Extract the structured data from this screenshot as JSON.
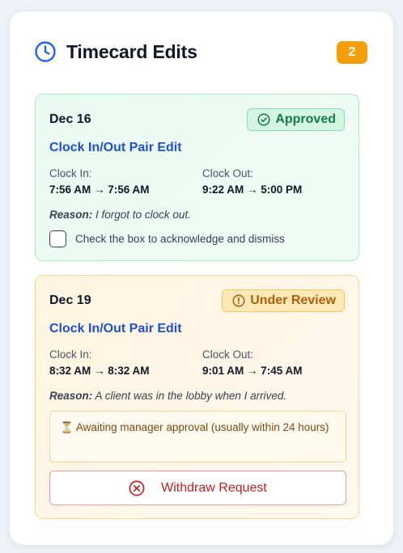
{
  "header": {
    "title": "Timecard Edits",
    "count": "2",
    "icon": "clock-icon",
    "accent": "#2563eb",
    "badge_color": "#f59e0b"
  },
  "cards": [
    {
      "date": "Dec 16",
      "status": "Approved",
      "status_icon": "check-circle-icon",
      "status_color": "#167a48",
      "edit_type": "Clock In/Out Pair Edit",
      "clock_in_label": "Clock In:",
      "clock_in_value": "7:56 AM → 7:56 AM",
      "clock_out_label": "Clock Out:",
      "clock_out_value": "9:22 AM → 5:00 PM",
      "reason_label": "Reason:",
      "reason_text": "I forgot to clock out.",
      "ack_label": "Check the box to acknowledge and dismiss",
      "ack_checked": false
    },
    {
      "date": "Dec 19",
      "status": "Under Review",
      "status_icon": "alert-circle-icon",
      "status_color": "#b35c0a",
      "edit_type": "Clock In/Out Pair Edit",
      "clock_in_label": "Clock In:",
      "clock_in_value": "8:32 AM → 8:32 AM",
      "clock_out_label": "Clock Out:",
      "clock_out_value": "9:01 AM → 7:45 AM",
      "reason_label": "Reason:",
      "reason_text": "A client was in the lobby when I arrived.",
      "awaiting_text": "⏳ Awaiting manager approval (usually within 24 hours)",
      "withdraw_label": "Withdraw Request",
      "withdraw_icon": "x-circle-icon"
    }
  ]
}
